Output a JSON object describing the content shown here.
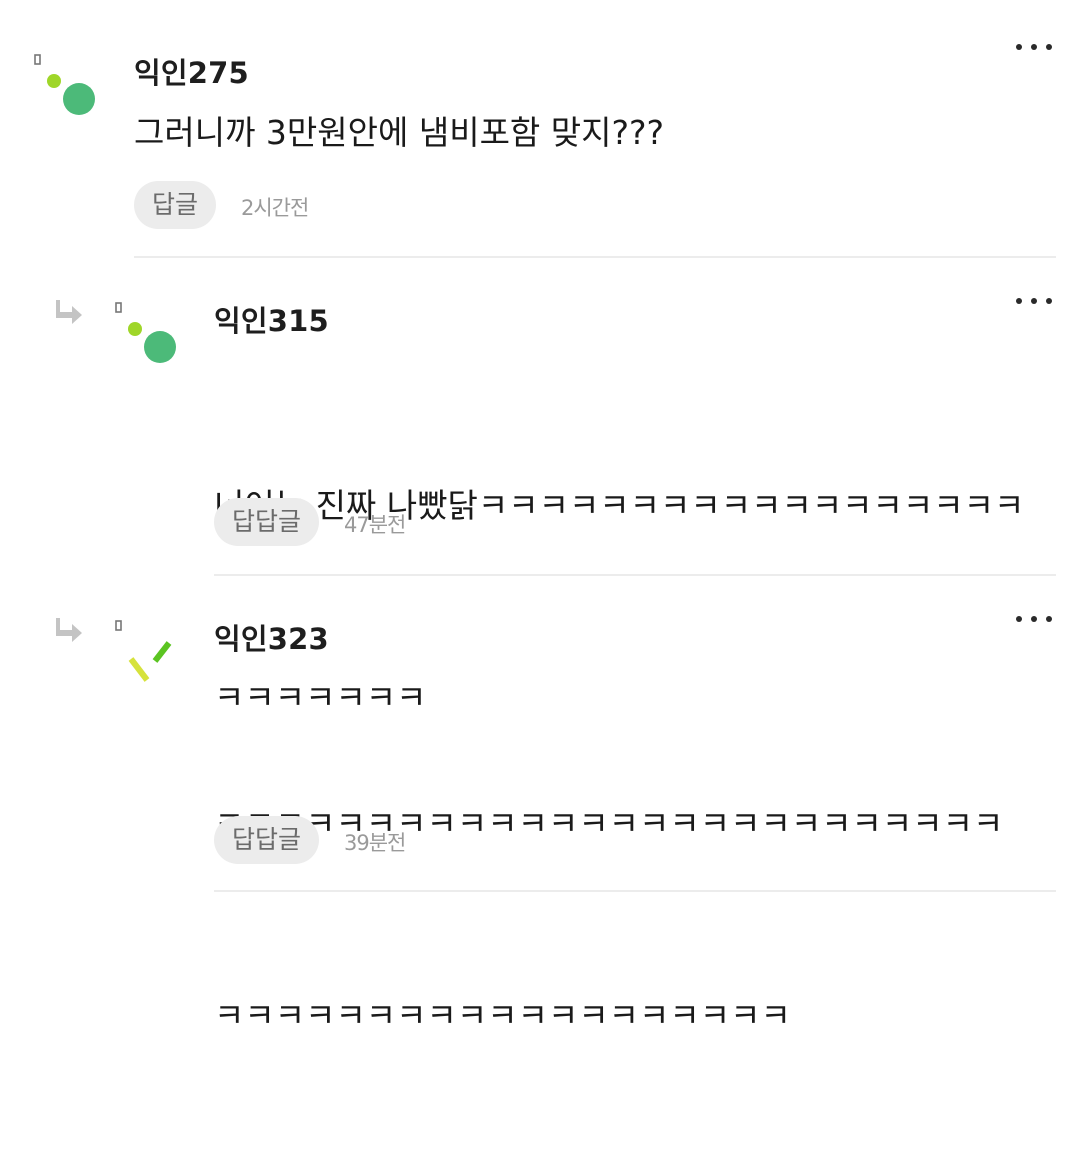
{
  "comments": [
    {
      "author": "익인275",
      "text": "그러니까 3만원안에 냄비포함 맞지???",
      "reply_label": "답글",
      "time": "2시간전",
      "more_icon": "more-dots-icon",
      "avatar_icon": "dots-avatar-icon"
    },
    {
      "author": "익인315",
      "text": "너어는 진짜 나빴닭ㅋㅋㅋㅋㅋㅋㅋㅋㅋㅋㅋㅋㅋㅋㅋㅋㅋㅋㅋㅋㅋㅋㅋㅋㅋ",
      "line1": "너어는 진짜 나빴닭ㅋㅋㅋㅋㅋㅋㅋㅋㅋㅋㅋㅋㅋㅋㅋㅋㅋㅋ",
      "line2": "ㅋㅋㅋㅋㅋㅋㅋ",
      "reply_label": "답답글",
      "time": "47분전",
      "more_icon": "more-dots-icon",
      "reply_arrow_icon": "reply-arrow-icon",
      "avatar_icon": "dots-avatar-icon"
    },
    {
      "author": "익인323",
      "line1": "ㅋㅋㅋㅋㅋㅋㅋㅋㅋㅋㅋㅋㅋㅋㅋㅋㅋㅋㅋㅋㅋㅋㅋㅋㅋㅋ",
      "line2": "ㅋㅋㅋㅋㅋㅋㅋㅋㅋㅋㅋㅋㅋㅋㅋㅋㅋㅋㅋ",
      "reply_label": "답답글",
      "time": "39분전",
      "more_icon": "more-dots-icon",
      "reply_arrow_icon": "reply-arrow-icon",
      "avatar_icon": "sticks-avatar-icon"
    }
  ],
  "colors": {
    "avatar_green": "#4cba79",
    "avatar_lime": "#9fd629",
    "stick_yellow": "#d6e23c",
    "stick_green": "#5bc421",
    "reply_btn_bg": "#ececec",
    "divider": "#ececec"
  }
}
